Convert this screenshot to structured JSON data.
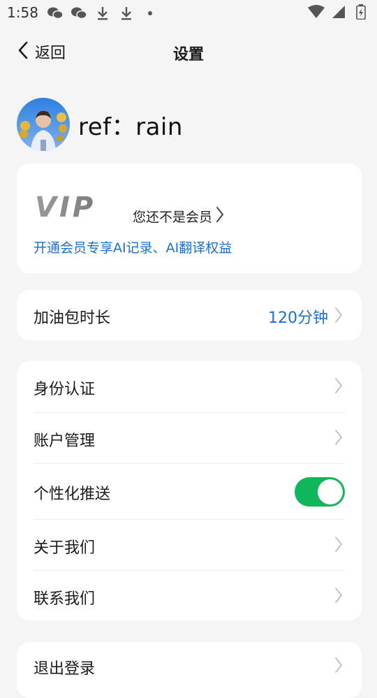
{
  "status_bar": {
    "time": "1:58",
    "left_icons": [
      "wechat-icon",
      "wechat-icon",
      "download-icon",
      "download-icon",
      "dot-icon"
    ],
    "right_icons": [
      "wifi-icon",
      "signal-icon",
      "battery-icon"
    ]
  },
  "header": {
    "back_label": "返回",
    "title": "设置"
  },
  "profile": {
    "username": "ref：rain"
  },
  "vip": {
    "logo_text": "VIP",
    "status": "您还不是会员",
    "description": "开通会员专享AI记录、AI翻译权益"
  },
  "fuel_pack": {
    "label": "加油包时长",
    "value": "120分钟"
  },
  "settings": {
    "items": [
      {
        "label": "身份认证"
      },
      {
        "label": "账户管理"
      },
      {
        "label": "个性化推送",
        "toggle_on": true
      },
      {
        "label": "关于我们"
      },
      {
        "label": "联系我们"
      }
    ]
  },
  "logout": {
    "label": "退出登录"
  },
  "colors": {
    "accent_blue": "#1a6fd8",
    "toggle_green": "#10b75a",
    "background": "#f5f5f5"
  }
}
